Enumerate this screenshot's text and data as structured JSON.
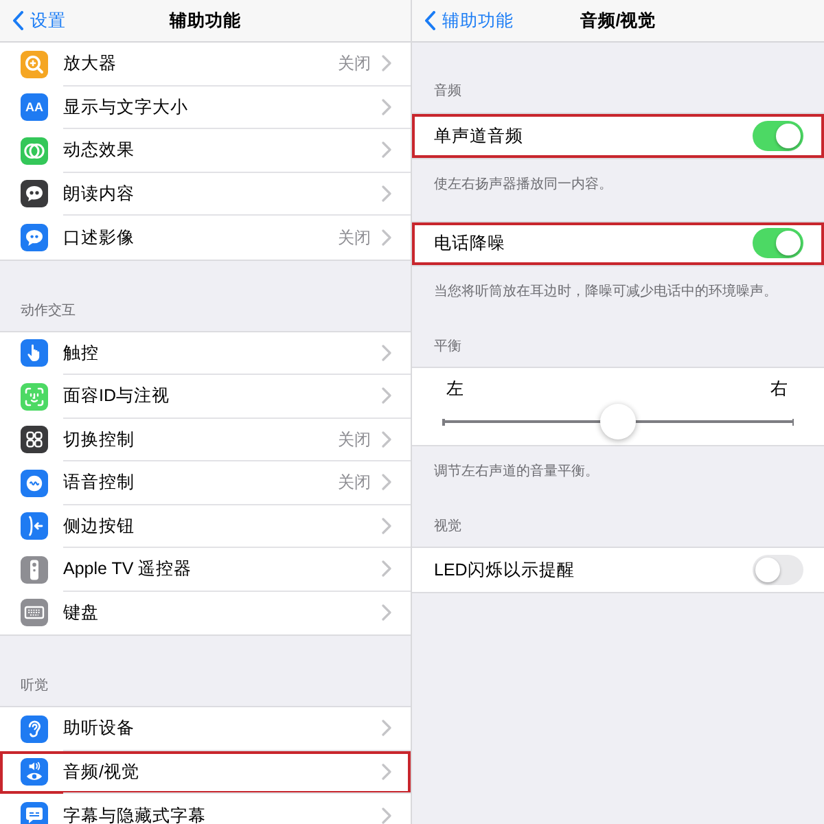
{
  "left_screen": {
    "nav_bar": {
      "back": "设置",
      "title": "辅助功能"
    },
    "sections": [
      {
        "items": [
          {
            "label": "放大器",
            "detail": "关闭",
            "highlighted": false
          },
          {
            "label": "显示与文字大小",
            "icon_text": "AA",
            "highlighted": false
          },
          {
            "label": "动态效果",
            "highlighted": false
          },
          {
            "label": "朗读内容",
            "highlighted": false
          },
          {
            "label": "口述影像",
            "detail": "关闭",
            "highlighted": false
          }
        ]
      },
      {
        "header": "动作交互",
        "items": [
          {
            "label": "触控",
            "highlighted": false
          },
          {
            "label": "面容ID与注视",
            "highlighted": false
          },
          {
            "label": "切换控制",
            "detail": "关闭",
            "highlighted": false
          },
          {
            "label": "语音控制",
            "detail": "关闭",
            "highlighted": false
          },
          {
            "label": "侧边按钮",
            "highlighted": false
          },
          {
            "label": "Apple TV 遥控器",
            "highlighted": false
          },
          {
            "label": "键盘",
            "highlighted": false
          }
        ]
      },
      {
        "header": "听觉",
        "items": [
          {
            "label": "助听设备",
            "highlighted": false
          },
          {
            "label": "音频/视觉",
            "highlighted": true
          },
          {
            "label": "字幕与隐藏式字幕",
            "highlighted": false
          }
        ]
      }
    ]
  },
  "right_screen": {
    "nav_bar": {
      "back": "辅助功能",
      "title": "音频/视觉"
    },
    "sections": [
      {
        "header": "音频",
        "rows": [
          {
            "kind": "toggle",
            "label": "单声道音频",
            "on": true,
            "highlighted": true
          }
        ],
        "footer": "使左右扬声器播放同一内容。"
      },
      {
        "rows": [
          {
            "kind": "toggle",
            "label": "电话降噪",
            "on": true,
            "highlighted": true
          }
        ],
        "footer": "当您将听筒放在耳边时，降噪可减少电话中的环境噪声。"
      },
      {
        "header": "平衡",
        "rows": [
          {
            "kind": "balance",
            "left_label": "左",
            "right_label": "右",
            "level": 0.5
          }
        ],
        "footer": "调节左右声道的音量平衡。"
      },
      {
        "header": "视觉",
        "rows": [
          {
            "kind": "toggle",
            "label": "LED闪烁以示提醒",
            "on": false,
            "highlighted": false
          }
        ]
      }
    ]
  }
}
